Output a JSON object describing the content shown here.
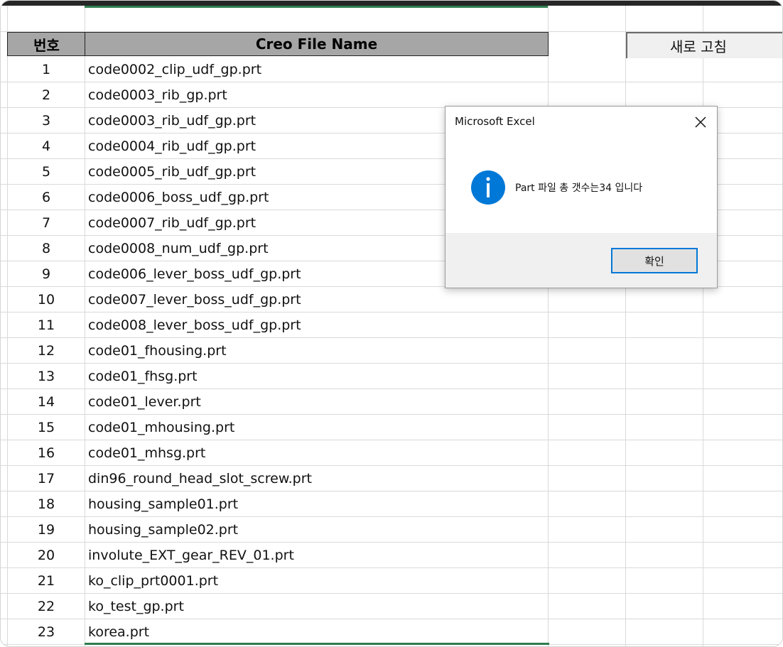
{
  "sheet": {
    "header": {
      "number_label": "번호",
      "name_label": "Creo File Name"
    },
    "refresh_button_label": "새로 고침",
    "rows": [
      {
        "no": "1",
        "name": "code0002_clip_udf_gp.prt"
      },
      {
        "no": "2",
        "name": "code0003_rib_gp.prt"
      },
      {
        "no": "3",
        "name": "code0003_rib_udf_gp.prt"
      },
      {
        "no": "4",
        "name": "code0004_rib_udf_gp.prt"
      },
      {
        "no": "5",
        "name": "code0005_rib_udf_gp.prt"
      },
      {
        "no": "6",
        "name": "code0006_boss_udf_gp.prt"
      },
      {
        "no": "7",
        "name": "code0007_rib_udf_gp.prt"
      },
      {
        "no": "8",
        "name": "code0008_num_udf_gp.prt"
      },
      {
        "no": "9",
        "name": "code006_lever_boss_udf_gp.prt"
      },
      {
        "no": "10",
        "name": "code007_lever_boss_udf_gp.prt"
      },
      {
        "no": "11",
        "name": "code008_lever_boss_udf_gp.prt"
      },
      {
        "no": "12",
        "name": "code01_fhousing.prt"
      },
      {
        "no": "13",
        "name": "code01_fhsg.prt"
      },
      {
        "no": "14",
        "name": "code01_lever.prt"
      },
      {
        "no": "15",
        "name": "code01_mhousing.prt"
      },
      {
        "no": "16",
        "name": "code01_mhsg.prt"
      },
      {
        "no": "17",
        "name": "din96_round_head_slot_screw.prt"
      },
      {
        "no": "18",
        "name": "housing_sample01.prt"
      },
      {
        "no": "19",
        "name": "housing_sample02.prt"
      },
      {
        "no": "20",
        "name": "involute_EXT_gear_REV_01.prt"
      },
      {
        "no": "21",
        "name": "ko_clip_prt0001.prt"
      },
      {
        "no": "22",
        "name": "ko_test_gp.prt"
      },
      {
        "no": "23",
        "name": "korea.prt"
      }
    ]
  },
  "dialog": {
    "title": "Microsoft Excel",
    "message": "Part 파일 총 갯수는34 입니다",
    "ok_label": "확인",
    "icon": "info-icon",
    "close_icon": "close-icon"
  },
  "colors": {
    "header_fill": "#a6a6a6",
    "selection_green": "#2e7d4f",
    "info_blue": "#0078d7"
  }
}
